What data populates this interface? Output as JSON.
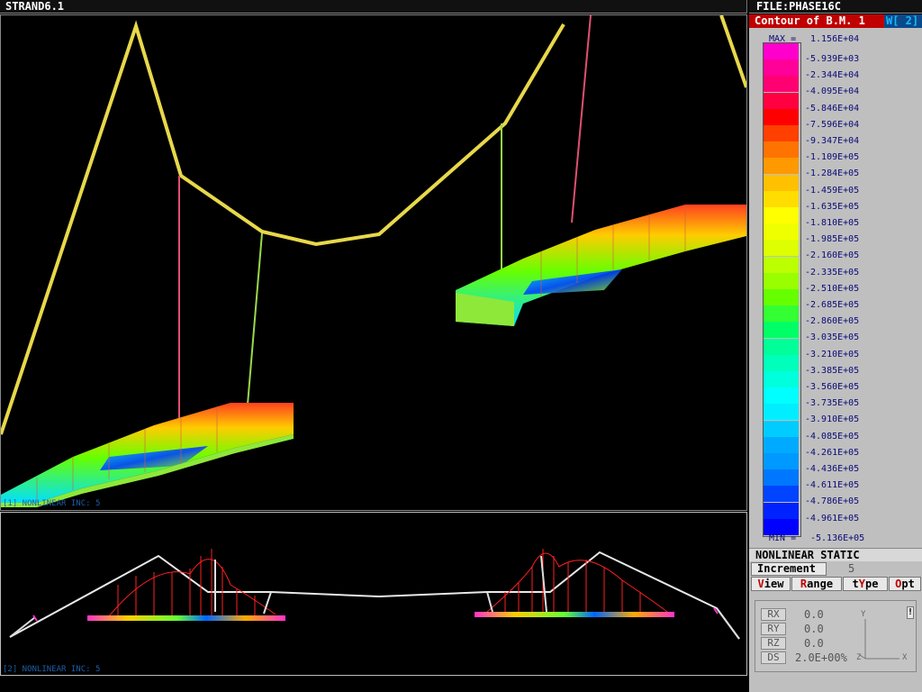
{
  "app": {
    "title": "STRAND6.1",
    "file": "FILE:PHASE16C"
  },
  "contour": {
    "title": "Contour of B.M. 1",
    "window_tag": "W[ 2]"
  },
  "legend": {
    "max_label": "MAX =",
    "max_value": "1.156E+04",
    "min_label": "MIN =",
    "min_value": "-5.136E+05",
    "entries": [
      {
        "value": "-5.939E+03",
        "color": "#ff00cc"
      },
      {
        "value": "-2.344E+04",
        "color": "#ff0099"
      },
      {
        "value": "-4.095E+04",
        "color": "#ff0073"
      },
      {
        "value": "-5.846E+04",
        "color": "#ff0040"
      },
      {
        "value": "-7.596E+04",
        "color": "#ff0000"
      },
      {
        "value": "-9.347E+04",
        "color": "#ff4000"
      },
      {
        "value": "-1.109E+05",
        "color": "#ff7300"
      },
      {
        "value": "-1.284E+05",
        "color": "#ff9900"
      },
      {
        "value": "-1.459E+05",
        "color": "#ffc000"
      },
      {
        "value": "-1.635E+05",
        "color": "#ffdd00"
      },
      {
        "value": "-1.810E+05",
        "color": "#ffff00"
      },
      {
        "value": "-1.985E+05",
        "color": "#f0ff00"
      },
      {
        "value": "-2.160E+05",
        "color": "#ddff00"
      },
      {
        "value": "-2.335E+05",
        "color": "#bbff00"
      },
      {
        "value": "-2.510E+05",
        "color": "#99ff00"
      },
      {
        "value": "-2.685E+05",
        "color": "#66ff00"
      },
      {
        "value": "-2.860E+05",
        "color": "#33ff33"
      },
      {
        "value": "-3.035E+05",
        "color": "#00ff66"
      },
      {
        "value": "-3.210E+05",
        "color": "#00ff99"
      },
      {
        "value": "-3.385E+05",
        "color": "#00ffbb"
      },
      {
        "value": "-3.560E+05",
        "color": "#00ffdd"
      },
      {
        "value": "-3.735E+05",
        "color": "#00ffff"
      },
      {
        "value": "-3.910E+05",
        "color": "#00eeff"
      },
      {
        "value": "-4.085E+05",
        "color": "#00ccff"
      },
      {
        "value": "-4.261E+05",
        "color": "#00aaff"
      },
      {
        "value": "-4.436E+05",
        "color": "#0099ff"
      },
      {
        "value": "-4.611E+05",
        "color": "#0077ff"
      },
      {
        "value": "-4.786E+05",
        "color": "#0044ff"
      },
      {
        "value": "-4.961E+05",
        "color": "#0022ff"
      },
      {
        "value": "",
        "color": "#0000ff"
      }
    ]
  },
  "viewports": {
    "main_label": "[1] NONLINEAR INC: 5",
    "elevation_label": "[2] NONLINEAR INC: 5"
  },
  "analysis": {
    "type": "NONLINEAR STATIC",
    "increment_label": "Increment",
    "increment_value": "5"
  },
  "menu": [
    {
      "hotkey": "V",
      "rest": "iew"
    },
    {
      "prefix": "",
      "hotkey": "R",
      "rest": "ange"
    },
    {
      "prefix": "t",
      "hotkey": "Y",
      "rest": "pe"
    },
    {
      "hotkey": "O",
      "rest": "pt"
    }
  ],
  "rotation": {
    "rx_label": "RX",
    "rx_value": "0.0",
    "ry_label": "RY",
    "ry_value": "0.0",
    "rz_label": "RZ",
    "rz_value": "0.0",
    "ds_label": "DS",
    "ds_value": "2.0E+00%"
  },
  "axes": {
    "y": "Y",
    "z": "Z",
    "x": "X"
  }
}
